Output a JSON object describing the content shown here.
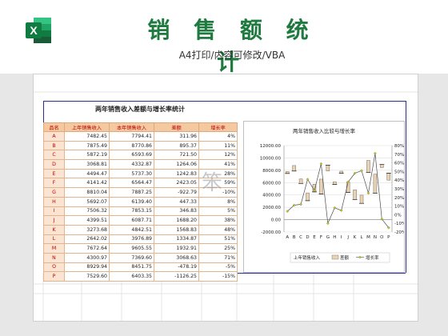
{
  "header": {
    "title": "销 售 额 统 计",
    "subtitle": "A4打印/内容可修改/VBA",
    "logo_letter": "X"
  },
  "sheet": {
    "title": "两年销售收入差额与增长率统计",
    "columns": [
      "品名",
      "上年销售收入",
      "本年销售收入",
      "差额",
      "增长率"
    ],
    "rows": [
      [
        "A",
        "7482.45",
        "7794.41",
        "311.96",
        "4%"
      ],
      [
        "B",
        "7875.49",
        "8770.86",
        "895.37",
        "11%"
      ],
      [
        "C",
        "5872.19",
        "6593.69",
        "721.50",
        "12%"
      ],
      [
        "D",
        "3068.81",
        "4332.87",
        "1264.06",
        "41%"
      ],
      [
        "E",
        "4494.47",
        "5737.30",
        "1242.83",
        "28%"
      ],
      [
        "F",
        "4141.42",
        "6564.47",
        "2423.05",
        "59%"
      ],
      [
        "G",
        "8810.04",
        "7887.25",
        "-922.79",
        "-10%"
      ],
      [
        "H",
        "5692.07",
        "6139.40",
        "447.33",
        "8%"
      ],
      [
        "I",
        "7506.32",
        "7853.15",
        "346.83",
        "5%"
      ],
      [
        "J",
        "4399.51",
        "6087.71",
        "1688.20",
        "38%"
      ],
      [
        "K",
        "3273.68",
        "4842.51",
        "1568.83",
        "48%"
      ],
      [
        "L",
        "2642.02",
        "3976.89",
        "1334.87",
        "51%"
      ],
      [
        "M",
        "7672.64",
        "9605.55",
        "1932.91",
        "25%"
      ],
      [
        "N",
        "4300.97",
        "7369.60",
        "3068.63",
        "71%"
      ],
      [
        "O",
        "8929.94",
        "8451.75",
        "-478.19",
        "-5%"
      ],
      [
        "P",
        "7529.60",
        "6403.35",
        "-1126.25",
        "-15%"
      ]
    ]
  },
  "chart_data": {
    "type": "bar",
    "title": "两年销售收入比较与增长率",
    "categories": [
      "A",
      "B",
      "C",
      "D",
      "E",
      "F",
      "G",
      "H",
      "I",
      "J",
      "K",
      "L",
      "M",
      "N",
      "O",
      "P"
    ],
    "series": [
      {
        "name": "上年销售收入",
        "values": [
          7482.45,
          7875.49,
          5872.19,
          3068.81,
          4494.47,
          4141.42,
          8810.04,
          5692.07,
          7506.32,
          4399.51,
          3273.68,
          2642.02,
          7672.64,
          4300.97,
          8929.94,
          7529.6
        ]
      },
      {
        "name": "差额",
        "values": [
          311.96,
          895.37,
          721.5,
          1264.06,
          1242.83,
          2423.05,
          -922.79,
          447.33,
          346.83,
          1688.2,
          1568.83,
          1334.87,
          1932.91,
          3068.63,
          -478.19,
          -1126.25
        ]
      },
      {
        "name": "增长率",
        "values": [
          4,
          11,
          12,
          41,
          28,
          59,
          -10,
          8,
          5,
          38,
          48,
          51,
          25,
          71,
          -5,
          -15
        ]
      }
    ],
    "left_axis": {
      "ticks": [
        "12000.00",
        "10000.00",
        "8000.00",
        "6000.00",
        "4000.00",
        "2000.00",
        "0.00",
        "-2000.00"
      ],
      "ylim": [
        -2000,
        12000
      ]
    },
    "right_axis": {
      "ticks": [
        "80%",
        "70%",
        "60%",
        "50%",
        "40%",
        "30%",
        "20%",
        "10%",
        "0%",
        "-10%",
        "-20%"
      ],
      "ylim": [
        -20,
        80
      ]
    },
    "legend_position": "bottom",
    "colors": {
      "bar": "#e8d3b8",
      "bar_border": "#7a6a55",
      "line": "#4d4d4d",
      "marker": "#c8c800",
      "floating_bar": "#000000"
    }
  },
  "colors": {
    "brand_green": "#1e7a3e",
    "header_fill": "#f4c9a0",
    "header_text": "#c00000"
  }
}
